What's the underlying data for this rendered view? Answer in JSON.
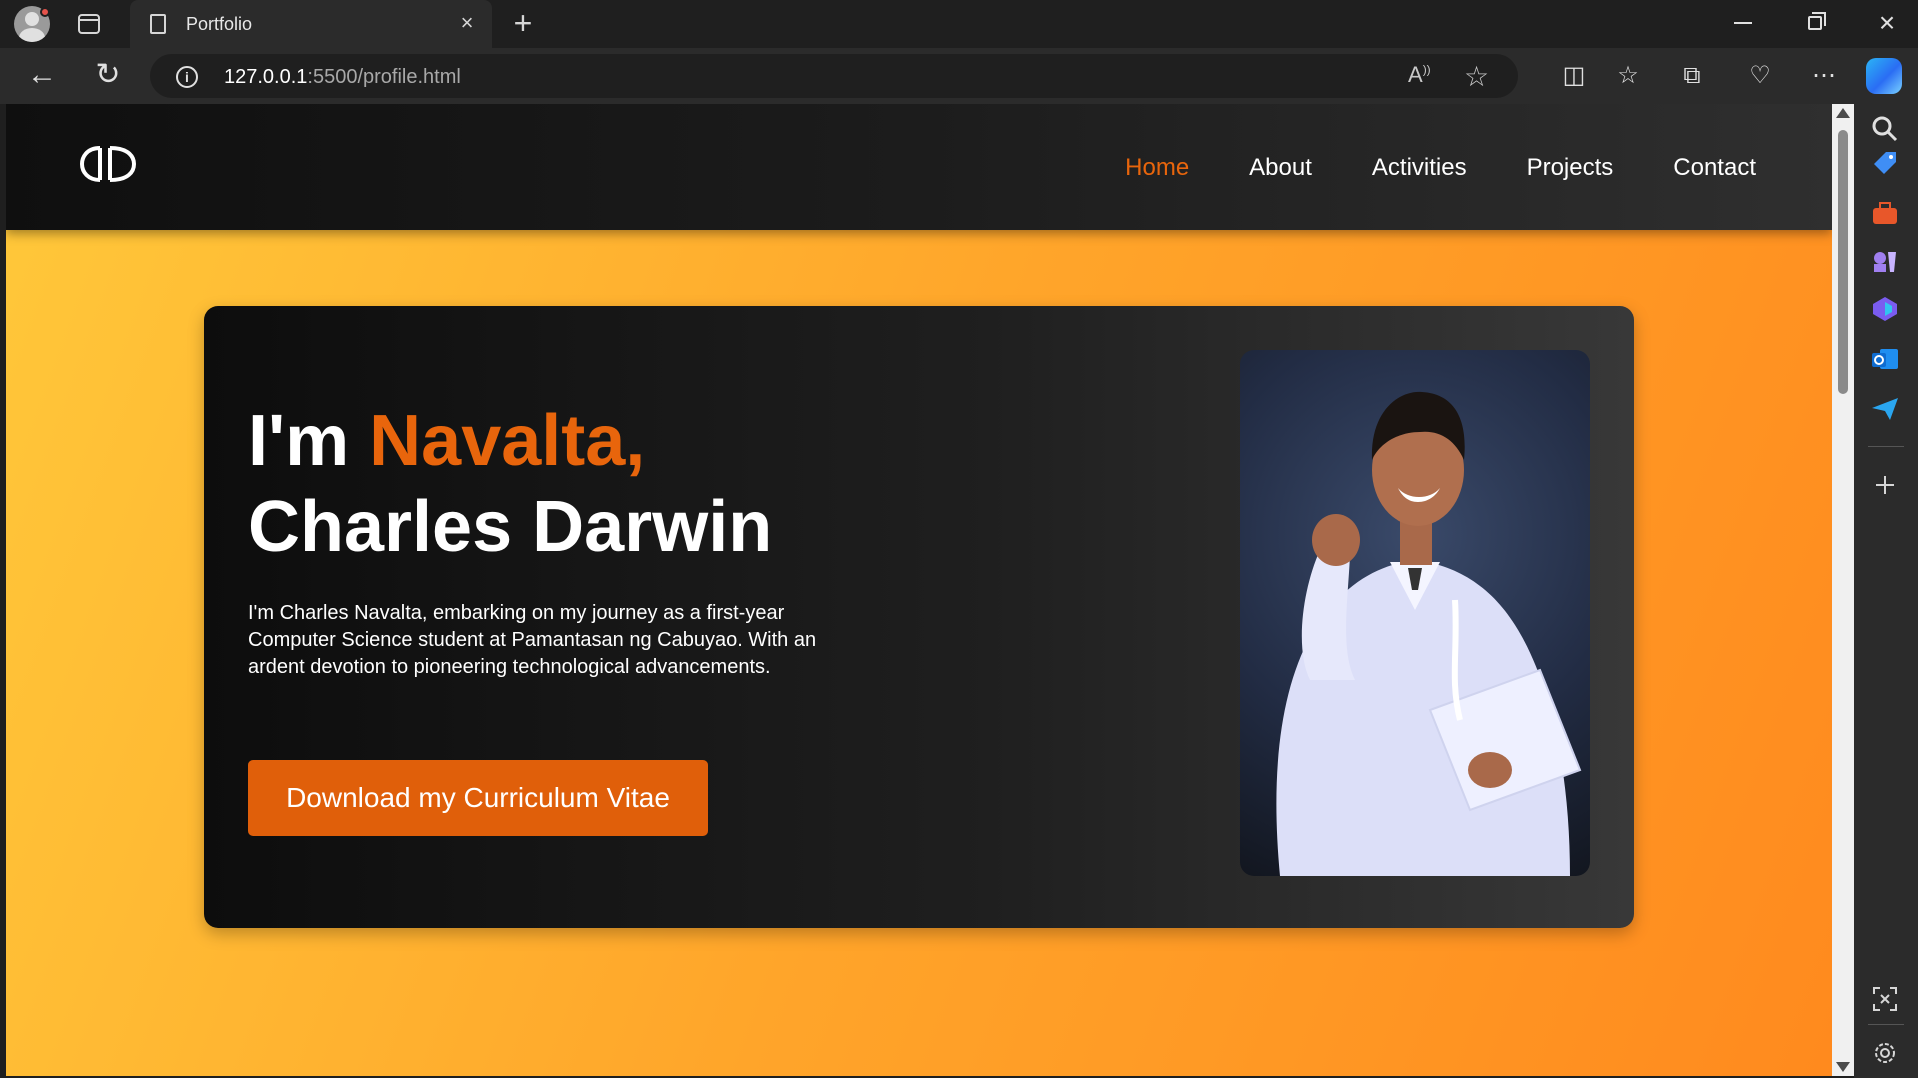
{
  "browser": {
    "tab_title": "Portfolio",
    "url_host": "127.0.0.1",
    "url_path": ":5500/profile.html"
  },
  "site": {
    "logo_alt": "CD",
    "nav": [
      {
        "label": "Home"
      },
      {
        "label": "About"
      },
      {
        "label": "Activities"
      },
      {
        "label": "Projects"
      },
      {
        "label": "Contact"
      }
    ],
    "active_nav": "Home"
  },
  "hero": {
    "greeting": "I'm ",
    "surname": "Navalta,",
    "given_name": "Charles Darwin",
    "description": "I'm Charles Navalta, embarking on my journey as a first-year Computer Science student at Pamantasan ng Cabuyao. With an ardent devotion to pioneering technological advancements.",
    "cta_label": "Download my Curriculum Vitae"
  },
  "colors": {
    "accent": "#e8650c",
    "background_gradient_start": "#ffc83a",
    "background_gradient_end": "#ff8a1e",
    "card": "#1a1a1a"
  }
}
